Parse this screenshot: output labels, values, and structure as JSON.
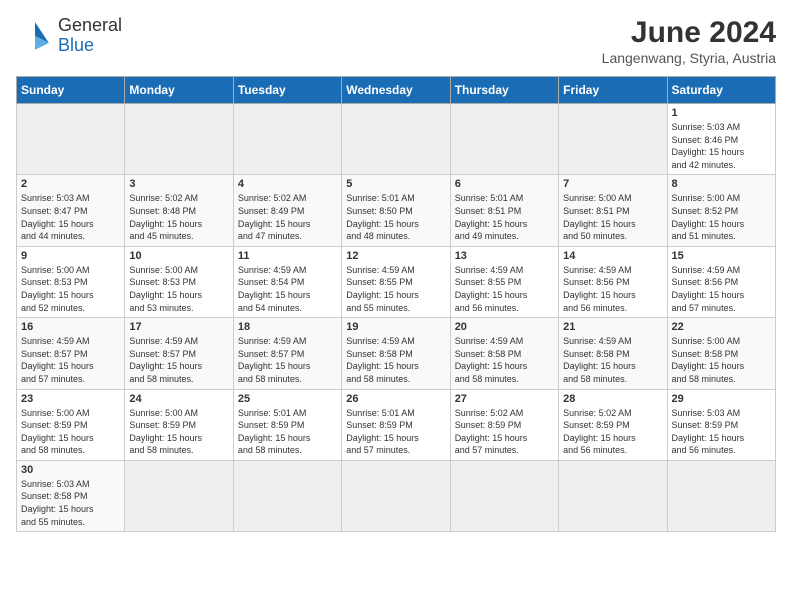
{
  "header": {
    "logo_line1": "General",
    "logo_line2": "Blue",
    "title": "June 2024",
    "subtitle": "Langenwang, Styria, Austria"
  },
  "weekdays": [
    "Sunday",
    "Monday",
    "Tuesday",
    "Wednesday",
    "Thursday",
    "Friday",
    "Saturday"
  ],
  "weeks": [
    [
      {
        "day": "",
        "info": ""
      },
      {
        "day": "",
        "info": ""
      },
      {
        "day": "",
        "info": ""
      },
      {
        "day": "",
        "info": ""
      },
      {
        "day": "",
        "info": ""
      },
      {
        "day": "",
        "info": ""
      },
      {
        "day": "1",
        "info": "Sunrise: 5:03 AM\nSunset: 8:46 PM\nDaylight: 15 hours\nand 42 minutes."
      }
    ],
    [
      {
        "day": "2",
        "info": "Sunrise: 5:03 AM\nSunset: 8:47 PM\nDaylight: 15 hours\nand 44 minutes."
      },
      {
        "day": "3",
        "info": "Sunrise: 5:02 AM\nSunset: 8:48 PM\nDaylight: 15 hours\nand 45 minutes."
      },
      {
        "day": "4",
        "info": "Sunrise: 5:02 AM\nSunset: 8:49 PM\nDaylight: 15 hours\nand 47 minutes."
      },
      {
        "day": "5",
        "info": "Sunrise: 5:01 AM\nSunset: 8:50 PM\nDaylight: 15 hours\nand 48 minutes."
      },
      {
        "day": "6",
        "info": "Sunrise: 5:01 AM\nSunset: 8:51 PM\nDaylight: 15 hours\nand 49 minutes."
      },
      {
        "day": "7",
        "info": "Sunrise: 5:00 AM\nSunset: 8:51 PM\nDaylight: 15 hours\nand 50 minutes."
      },
      {
        "day": "8",
        "info": "Sunrise: 5:00 AM\nSunset: 8:52 PM\nDaylight: 15 hours\nand 51 minutes."
      }
    ],
    [
      {
        "day": "9",
        "info": "Sunrise: 5:00 AM\nSunset: 8:53 PM\nDaylight: 15 hours\nand 52 minutes."
      },
      {
        "day": "10",
        "info": "Sunrise: 5:00 AM\nSunset: 8:53 PM\nDaylight: 15 hours\nand 53 minutes."
      },
      {
        "day": "11",
        "info": "Sunrise: 4:59 AM\nSunset: 8:54 PM\nDaylight: 15 hours\nand 54 minutes."
      },
      {
        "day": "12",
        "info": "Sunrise: 4:59 AM\nSunset: 8:55 PM\nDaylight: 15 hours\nand 55 minutes."
      },
      {
        "day": "13",
        "info": "Sunrise: 4:59 AM\nSunset: 8:55 PM\nDaylight: 15 hours\nand 56 minutes."
      },
      {
        "day": "14",
        "info": "Sunrise: 4:59 AM\nSunset: 8:56 PM\nDaylight: 15 hours\nand 56 minutes."
      },
      {
        "day": "15",
        "info": "Sunrise: 4:59 AM\nSunset: 8:56 PM\nDaylight: 15 hours\nand 57 minutes."
      }
    ],
    [
      {
        "day": "16",
        "info": "Sunrise: 4:59 AM\nSunset: 8:57 PM\nDaylight: 15 hours\nand 57 minutes."
      },
      {
        "day": "17",
        "info": "Sunrise: 4:59 AM\nSunset: 8:57 PM\nDaylight: 15 hours\nand 58 minutes."
      },
      {
        "day": "18",
        "info": "Sunrise: 4:59 AM\nSunset: 8:57 PM\nDaylight: 15 hours\nand 58 minutes."
      },
      {
        "day": "19",
        "info": "Sunrise: 4:59 AM\nSunset: 8:58 PM\nDaylight: 15 hours\nand 58 minutes."
      },
      {
        "day": "20",
        "info": "Sunrise: 4:59 AM\nSunset: 8:58 PM\nDaylight: 15 hours\nand 58 minutes."
      },
      {
        "day": "21",
        "info": "Sunrise: 4:59 AM\nSunset: 8:58 PM\nDaylight: 15 hours\nand 58 minutes."
      },
      {
        "day": "22",
        "info": "Sunrise: 5:00 AM\nSunset: 8:58 PM\nDaylight: 15 hours\nand 58 minutes."
      }
    ],
    [
      {
        "day": "23",
        "info": "Sunrise: 5:00 AM\nSunset: 8:59 PM\nDaylight: 15 hours\nand 58 minutes."
      },
      {
        "day": "24",
        "info": "Sunrise: 5:00 AM\nSunset: 8:59 PM\nDaylight: 15 hours\nand 58 minutes."
      },
      {
        "day": "25",
        "info": "Sunrise: 5:01 AM\nSunset: 8:59 PM\nDaylight: 15 hours\nand 58 minutes."
      },
      {
        "day": "26",
        "info": "Sunrise: 5:01 AM\nSunset: 8:59 PM\nDaylight: 15 hours\nand 57 minutes."
      },
      {
        "day": "27",
        "info": "Sunrise: 5:02 AM\nSunset: 8:59 PM\nDaylight: 15 hours\nand 57 minutes."
      },
      {
        "day": "28",
        "info": "Sunrise: 5:02 AM\nSunset: 8:59 PM\nDaylight: 15 hours\nand 56 minutes."
      },
      {
        "day": "29",
        "info": "Sunrise: 5:03 AM\nSunset: 8:59 PM\nDaylight: 15 hours\nand 56 minutes."
      }
    ],
    [
      {
        "day": "30",
        "info": "Sunrise: 5:03 AM\nSunset: 8:58 PM\nDaylight: 15 hours\nand 55 minutes."
      },
      {
        "day": "",
        "info": ""
      },
      {
        "day": "",
        "info": ""
      },
      {
        "day": "",
        "info": ""
      },
      {
        "day": "",
        "info": ""
      },
      {
        "day": "",
        "info": ""
      },
      {
        "day": "",
        "info": ""
      }
    ]
  ]
}
